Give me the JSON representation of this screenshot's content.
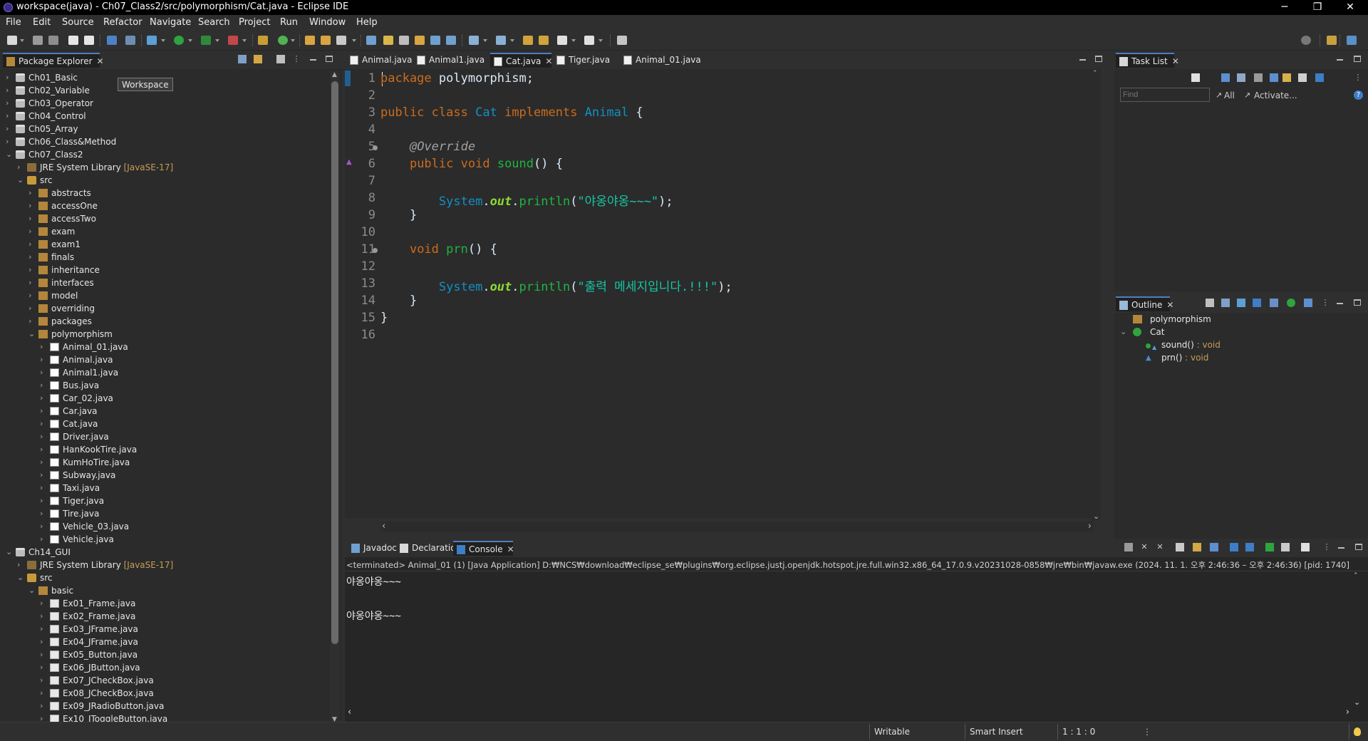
{
  "window": {
    "title": "workspace(java) - Ch07_Class2/src/polymorphism/Cat.java - Eclipse IDE",
    "minimize": "─",
    "restore": "❐",
    "close": "✕"
  },
  "menu": [
    "File",
    "Edit",
    "Source",
    "Refactor",
    "Navigate",
    "Search",
    "Project",
    "Run",
    "Window",
    "Help"
  ],
  "package_explorer": {
    "title": "Package Explorer",
    "tooltip": "Workspace",
    "rows": [
      {
        "label": "Ch01_Basic",
        "indent": 0,
        "twisty": "›",
        "icon": "proj"
      },
      {
        "label": "Ch02_Variable",
        "indent": 0,
        "twisty": "›",
        "icon": "proj"
      },
      {
        "label": "Ch03_Operator",
        "indent": 0,
        "twisty": "›",
        "icon": "proj"
      },
      {
        "label": "Ch04_Control",
        "indent": 0,
        "twisty": "›",
        "icon": "proj"
      },
      {
        "label": "Ch05_Array",
        "indent": 0,
        "twisty": "›",
        "icon": "proj"
      },
      {
        "label": "Ch06_Class&Method",
        "indent": 0,
        "twisty": "›",
        "icon": "proj"
      },
      {
        "label": "Ch07_Class2",
        "indent": 0,
        "twisty": "⌄",
        "icon": "proj"
      },
      {
        "label": "JRE System Library",
        "deco": "[JavaSE-17]",
        "indent": 1,
        "twisty": "›",
        "icon": "lib"
      },
      {
        "label": "src",
        "indent": 1,
        "twisty": "⌄",
        "icon": "src"
      },
      {
        "label": "abstracts",
        "indent": 2,
        "twisty": "›",
        "icon": "pkg"
      },
      {
        "label": "accessOne",
        "indent": 2,
        "twisty": "›",
        "icon": "pkg"
      },
      {
        "label": "accessTwo",
        "indent": 2,
        "twisty": "›",
        "icon": "pkg"
      },
      {
        "label": "exam",
        "indent": 2,
        "twisty": "›",
        "icon": "pkg"
      },
      {
        "label": "exam1",
        "indent": 2,
        "twisty": "›",
        "icon": "pkg"
      },
      {
        "label": "finals",
        "indent": 2,
        "twisty": "›",
        "icon": "pkg"
      },
      {
        "label": "inheritance",
        "indent": 2,
        "twisty": "›",
        "icon": "pkg"
      },
      {
        "label": "interfaces",
        "indent": 2,
        "twisty": "›",
        "icon": "pkg"
      },
      {
        "label": "model",
        "indent": 2,
        "twisty": "›",
        "icon": "pkg"
      },
      {
        "label": "overriding",
        "indent": 2,
        "twisty": "›",
        "icon": "pkg"
      },
      {
        "label": "packages",
        "indent": 2,
        "twisty": "›",
        "icon": "pkg"
      },
      {
        "label": "polymorphism",
        "indent": 2,
        "twisty": "⌄",
        "icon": "pkg"
      },
      {
        "label": "Animal_01.java",
        "indent": 3,
        "twisty": "›",
        "icon": "file"
      },
      {
        "label": "Animal.java",
        "indent": 3,
        "twisty": "›",
        "icon": "file"
      },
      {
        "label": "Animal1.java",
        "indent": 3,
        "twisty": "›",
        "icon": "file"
      },
      {
        "label": "Bus.java",
        "indent": 3,
        "twisty": "›",
        "icon": "file"
      },
      {
        "label": "Car_02.java",
        "indent": 3,
        "twisty": "›",
        "icon": "file"
      },
      {
        "label": "Car.java",
        "indent": 3,
        "twisty": "›",
        "icon": "file"
      },
      {
        "label": "Cat.java",
        "indent": 3,
        "twisty": "›",
        "icon": "file"
      },
      {
        "label": "Driver.java",
        "indent": 3,
        "twisty": "›",
        "icon": "file"
      },
      {
        "label": "HanKookTire.java",
        "indent": 3,
        "twisty": "›",
        "icon": "file"
      },
      {
        "label": "KumHoTire.java",
        "indent": 3,
        "twisty": "›",
        "icon": "file"
      },
      {
        "label": "Subway.java",
        "indent": 3,
        "twisty": "›",
        "icon": "file"
      },
      {
        "label": "Taxi.java",
        "indent": 3,
        "twisty": "›",
        "icon": "file"
      },
      {
        "label": "Tiger.java",
        "indent": 3,
        "twisty": "›",
        "icon": "file"
      },
      {
        "label": "Tire.java",
        "indent": 3,
        "twisty": "›",
        "icon": "file"
      },
      {
        "label": "Vehicle_03.java",
        "indent": 3,
        "twisty": "›",
        "icon": "file"
      },
      {
        "label": "Vehicle.java",
        "indent": 3,
        "twisty": "›",
        "icon": "file"
      },
      {
        "label": "Ch14_GUI",
        "indent": 0,
        "twisty": "⌄",
        "icon": "proj"
      },
      {
        "label": "JRE System Library",
        "deco": "[JavaSE-17]",
        "indent": 1,
        "twisty": "›",
        "icon": "lib"
      },
      {
        "label": "src",
        "indent": 1,
        "twisty": "⌄",
        "icon": "src"
      },
      {
        "label": "basic",
        "indent": 2,
        "twisty": "⌄",
        "icon": "pkg"
      },
      {
        "label": "Ex01_Frame.java",
        "indent": 3,
        "twisty": "›",
        "icon": "frm"
      },
      {
        "label": "Ex02_Frame.java",
        "indent": 3,
        "twisty": "›",
        "icon": "frm"
      },
      {
        "label": "Ex03_JFrame.java",
        "indent": 3,
        "twisty": "›",
        "icon": "frm"
      },
      {
        "label": "Ex04_JFrame.java",
        "indent": 3,
        "twisty": "›",
        "icon": "frm"
      },
      {
        "label": "Ex05_Button.java",
        "indent": 3,
        "twisty": "›",
        "icon": "frm"
      },
      {
        "label": "Ex06_JButton.java",
        "indent": 3,
        "twisty": "›",
        "icon": "frm"
      },
      {
        "label": "Ex07_JCheckBox.java",
        "indent": 3,
        "twisty": "›",
        "icon": "frm"
      },
      {
        "label": "Ex08_JCheckBox.java",
        "indent": 3,
        "twisty": "›",
        "icon": "frm"
      },
      {
        "label": "Ex09_JRadioButton.java",
        "indent": 3,
        "twisty": "›",
        "icon": "frm"
      },
      {
        "label": "Ex10_JToggleButton.java",
        "indent": 3,
        "twisty": "›",
        "icon": "frm"
      }
    ]
  },
  "editor": {
    "tabs": [
      {
        "label": "Animal.java",
        "active": false
      },
      {
        "label": "Animal1.java",
        "active": false
      },
      {
        "label": "Cat.java",
        "active": true
      },
      {
        "label": "Tiger.java",
        "active": false
      },
      {
        "label": "Animal_01.java",
        "active": false
      }
    ],
    "lines": [
      [
        {
          "t": "package",
          "c": "kw"
        },
        {
          "t": " polymorphism;",
          "c": "pl"
        }
      ],
      [],
      [
        {
          "t": "public",
          "c": "kw"
        },
        {
          "t": " ",
          "c": "pl"
        },
        {
          "t": "class",
          "c": "kw"
        },
        {
          "t": " ",
          "c": "pl"
        },
        {
          "t": "Cat",
          "c": "ty"
        },
        {
          "t": " ",
          "c": "pl"
        },
        {
          "t": "implements",
          "c": "kw"
        },
        {
          "t": " ",
          "c": "pl"
        },
        {
          "t": "Animal",
          "c": "ty"
        },
        {
          "t": " {",
          "c": "pl"
        }
      ],
      [],
      [
        {
          "t": "    ",
          "c": "pl"
        },
        {
          "t": "@Override",
          "c": "an"
        }
      ],
      [
        {
          "t": "    ",
          "c": "pl"
        },
        {
          "t": "public",
          "c": "kw"
        },
        {
          "t": " ",
          "c": "pl"
        },
        {
          "t": "void",
          "c": "kw"
        },
        {
          "t": " ",
          "c": "pl"
        },
        {
          "t": "sound",
          "c": "mt"
        },
        {
          "t": "() {",
          "c": "pl"
        }
      ],
      [],
      [
        {
          "t": "        ",
          "c": "pl"
        },
        {
          "t": "System",
          "c": "ty"
        },
        {
          "t": ".",
          "c": "pl"
        },
        {
          "t": "out",
          "c": "sf"
        },
        {
          "t": ".",
          "c": "pl"
        },
        {
          "t": "println",
          "c": "mt"
        },
        {
          "t": "(",
          "c": "pl"
        },
        {
          "t": "\"야옹야옹~~~\"",
          "c": "st"
        },
        {
          "t": ");",
          "c": "pl"
        }
      ],
      [
        {
          "t": "    }",
          "c": "pl"
        }
      ],
      [],
      [
        {
          "t": "    ",
          "c": "pl"
        },
        {
          "t": "void",
          "c": "kw"
        },
        {
          "t": " ",
          "c": "pl"
        },
        {
          "t": "prn",
          "c": "mt"
        },
        {
          "t": "() {",
          "c": "pl"
        }
      ],
      [],
      [
        {
          "t": "        ",
          "c": "pl"
        },
        {
          "t": "System",
          "c": "ty"
        },
        {
          "t": ".",
          "c": "pl"
        },
        {
          "t": "out",
          "c": "sf"
        },
        {
          "t": ".",
          "c": "pl"
        },
        {
          "t": "println",
          "c": "mt"
        },
        {
          "t": "(",
          "c": "pl"
        },
        {
          "t": "\"출력 메세지입니다.!!!\"",
          "c": "st"
        },
        {
          "t": ");",
          "c": "pl"
        }
      ],
      [
        {
          "t": "    }",
          "c": "pl"
        }
      ],
      [
        {
          "t": "}",
          "c": "pl"
        }
      ],
      []
    ],
    "fold_lines": [
      5,
      11
    ]
  },
  "task_list": {
    "title": "Task List",
    "find_placeholder": "Find",
    "all_label": "All",
    "activate_label": "Activate..."
  },
  "outline": {
    "title": "Outline",
    "items": [
      {
        "label": "polymorphism",
        "type": "",
        "indent": 0
      },
      {
        "label": "Cat",
        "type": "",
        "indent": 0
      },
      {
        "label": "sound()",
        "type": " : void",
        "indent": 1
      },
      {
        "label": "prn()",
        "type": " : void",
        "indent": 1
      }
    ]
  },
  "bottom": {
    "tabs": [
      {
        "label": "Javadoc",
        "active": false
      },
      {
        "label": "Declaration",
        "active": false
      },
      {
        "label": "Console",
        "active": true
      }
    ],
    "console_header": "<terminated> Animal_01 (1) [Java Application] D:₩NCS₩download₩eclipse_se₩plugins₩org.eclipse.justj.openjdk.hotspot.jre.full.win32.x86_64_17.0.9.v20231028-0858₩jre₩bin₩javaw.exe  (2024. 11. 1. 오후 2:46:36 – 오후 2:46:36) [pid: 1740]",
    "console_lines": [
      "야옹야옹~~~",
      "",
      "야옹야옹~~~"
    ]
  },
  "status": {
    "writable": "Writable",
    "insert": "Smart Insert",
    "position": "1 : 1 : 0"
  },
  "colors": {
    "accent": "#4d7fbf",
    "keyword": "#cc6c1d",
    "type": "#1290c3",
    "method": "#1eb540",
    "string": "#17c6a3"
  }
}
